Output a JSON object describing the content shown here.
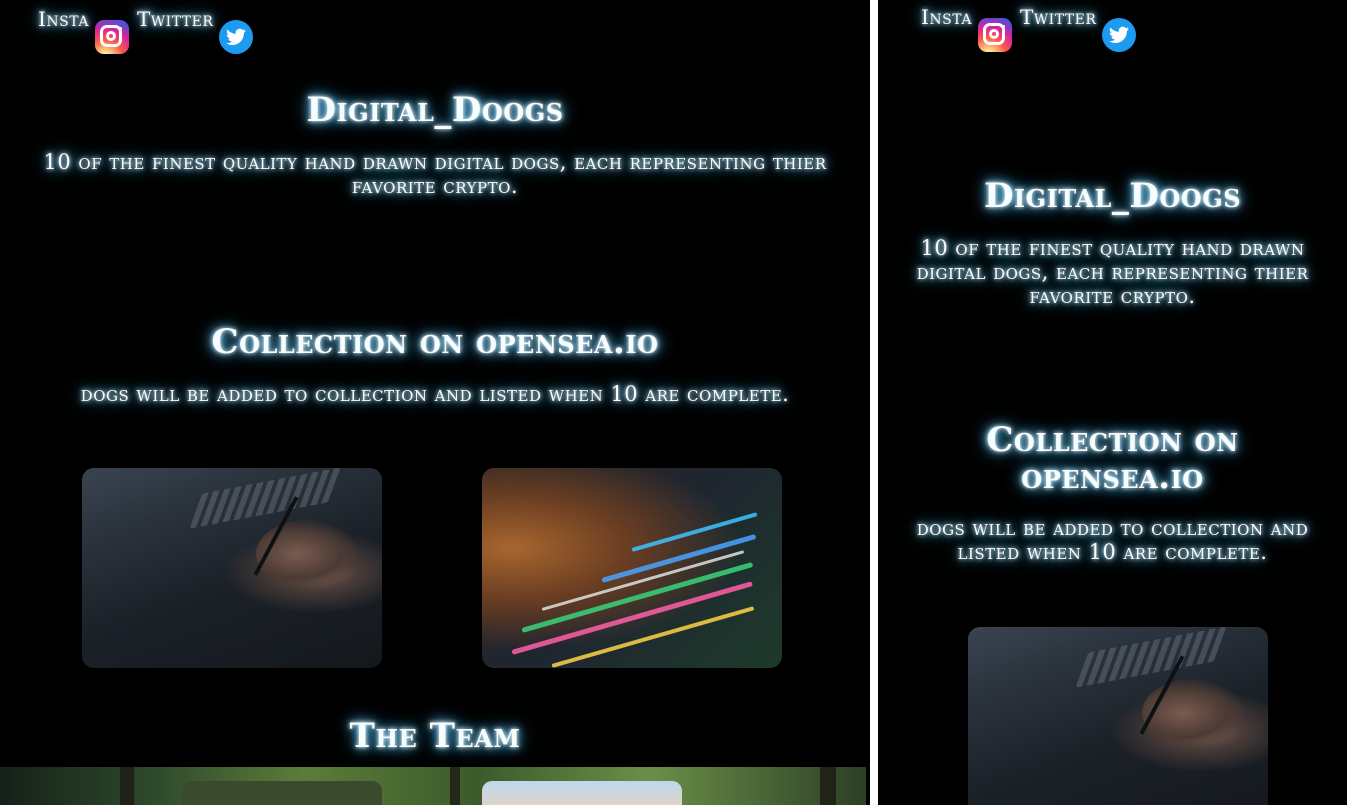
{
  "social": {
    "insta_label": "Insta",
    "twitter_label": "Twitter",
    "insta_icon": "instagram-icon",
    "twitter_icon": "twitter-bird-icon"
  },
  "hero": {
    "title": "Digital_Doogs",
    "description": "10 of the finest quality hand drawn digital dogs, each representing thier favorite crypto."
  },
  "collection": {
    "title": "Collection on opensea.io",
    "description": "dogs will be added to collection and listed when 10 are complete."
  },
  "team": {
    "title": "The Team"
  },
  "colors": {
    "background": "#000000",
    "text": "#f6fdff",
    "glow": "#6fd6ff",
    "twitter_blue": "#1d9bf0"
  }
}
